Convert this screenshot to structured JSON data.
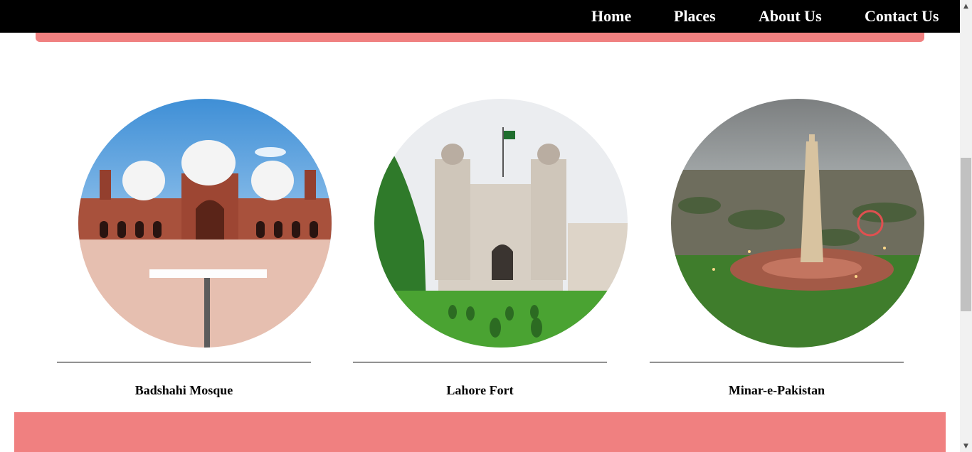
{
  "nav": {
    "items": [
      {
        "label": "Home"
      },
      {
        "label": "Places"
      },
      {
        "label": "About Us"
      },
      {
        "label": "Contact Us"
      }
    ]
  },
  "places": [
    {
      "name": "Badshahi Mosque",
      "icon": "mosque-photo"
    },
    {
      "name": "Lahore Fort",
      "icon": "fort-photo"
    },
    {
      "name": "Minar-e-Pakistan",
      "icon": "minar-photo"
    }
  ],
  "colors": {
    "nav_bg": "#000000",
    "accent": "#f08080",
    "divider": "#000000"
  }
}
